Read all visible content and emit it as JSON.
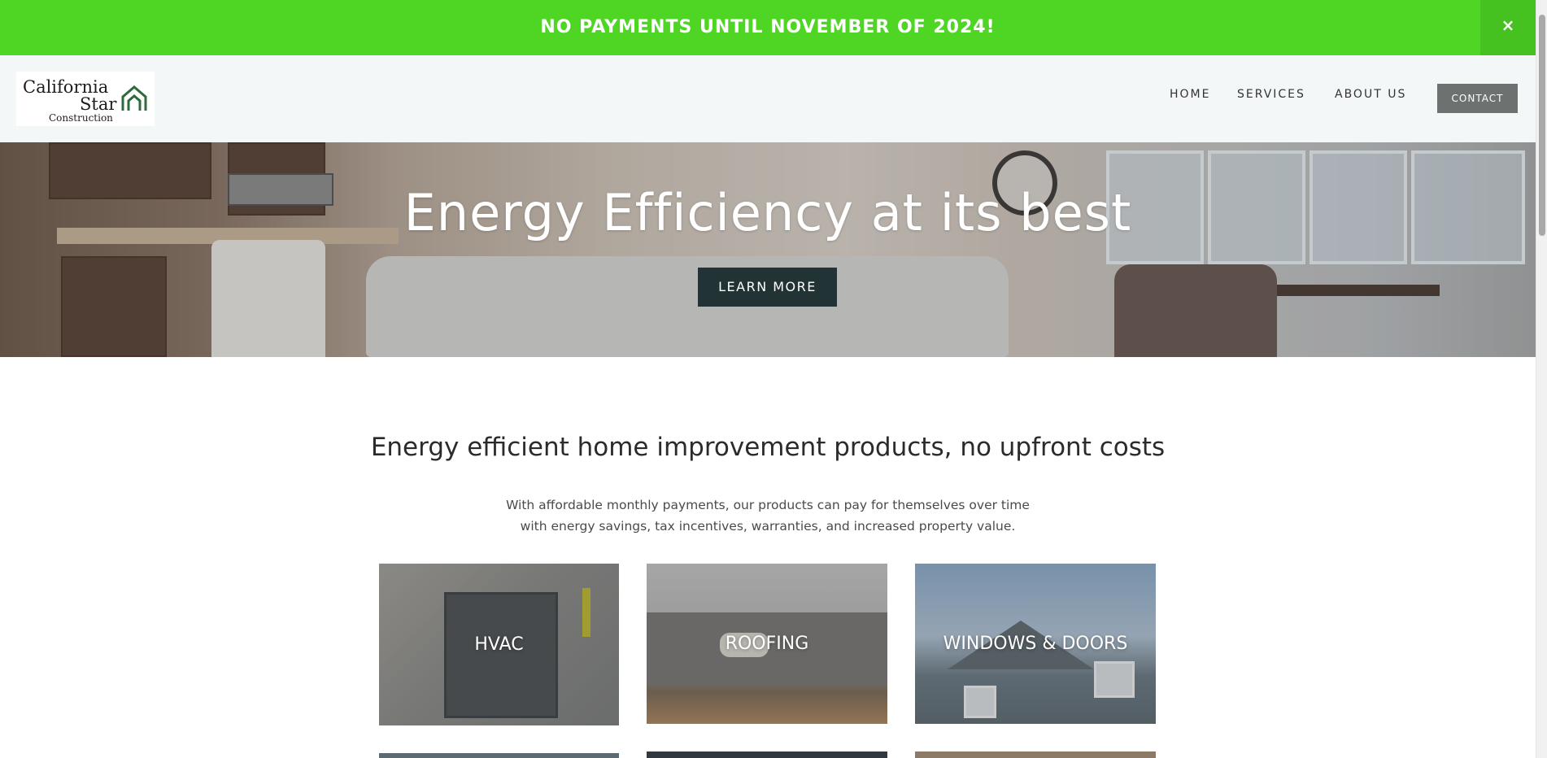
{
  "promo": {
    "text": "NO PAYMENTS UNTIL NOVEMBER OF 2024!",
    "close_label": "×"
  },
  "header": {
    "logo": {
      "line1": "California",
      "line2": "Star",
      "line3": "Construction"
    },
    "nav": [
      {
        "label": "HOME"
      },
      {
        "label": "SERVICES"
      },
      {
        "label": "ABOUT US"
      }
    ],
    "contact_label": "CONTACT"
  },
  "hero": {
    "title": "Energy Efficiency at its best",
    "button_label": "LEARN MORE"
  },
  "intro": {
    "heading": "Energy efficient home improvement products, no upfront costs",
    "text_line1": "With affordable monthly payments, our products can pay for themselves over time",
    "text_line2": "with energy savings, tax incentives, warranties, and increased property value."
  },
  "services": [
    {
      "label": "HVAC"
    },
    {
      "label": "ROOFING"
    },
    {
      "label": "WINDOWS & DOORS"
    }
  ],
  "colors": {
    "promo_green": "#4fd625",
    "hero_button": "#213335",
    "contact_button": "#6b726f",
    "logo_house": "#2e6b3c"
  }
}
